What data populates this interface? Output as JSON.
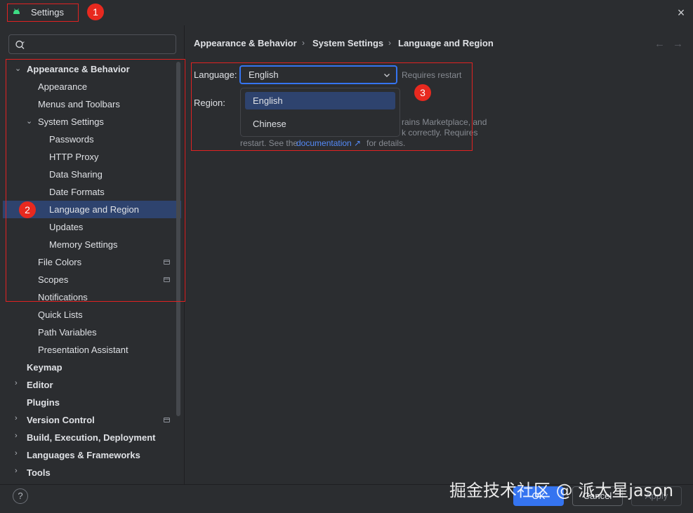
{
  "window": {
    "title": "Settings",
    "close_glyph": "×"
  },
  "annotations": [
    "1",
    "2",
    "3"
  ],
  "sidebar": {
    "search_placeholder": "",
    "items": [
      {
        "label": "Appearance & Behavior",
        "expanded": true
      },
      {
        "label": "Appearance"
      },
      {
        "label": "Menus and Toolbars"
      },
      {
        "label": "System Settings",
        "expanded": true
      },
      {
        "label": "Passwords"
      },
      {
        "label": "HTTP Proxy"
      },
      {
        "label": "Data Sharing"
      },
      {
        "label": "Date Formats"
      },
      {
        "label": "Language and Region",
        "selected": true
      },
      {
        "label": "Updates"
      },
      {
        "label": "Memory Settings"
      },
      {
        "label": "File Colors",
        "project_icon": true
      },
      {
        "label": "Scopes",
        "project_icon": true
      },
      {
        "label": "Notifications"
      },
      {
        "label": "Quick Lists"
      },
      {
        "label": "Path Variables"
      },
      {
        "label": "Presentation Assistant"
      },
      {
        "label": "Keymap"
      },
      {
        "label": "Editor",
        "expanded": false
      },
      {
        "label": "Plugins"
      },
      {
        "label": "Version Control",
        "expanded": false,
        "project_icon": true
      },
      {
        "label": "Build, Execution, Deployment",
        "expanded": false
      },
      {
        "label": "Languages & Frameworks",
        "expanded": false
      },
      {
        "label": "Tools",
        "expanded": false
      }
    ]
  },
  "breadcrumb": [
    "Appearance & Behavior",
    "System Settings",
    "Language and Region"
  ],
  "breadcrumb_sep": "›",
  "nav": {
    "back": "←",
    "forward": "→"
  },
  "language": {
    "label": "Language:",
    "value": "English",
    "hint": "Requires restart",
    "options": [
      "English",
      "Chinese"
    ]
  },
  "region": {
    "label": "Region:",
    "desc_line1": "rains Marketplace, and",
    "desc_line2": "k correctly. Requires",
    "desc_line3_prefix": "restart. See the",
    "desc_link": "documentation ↗",
    "desc_line3_suffix": "for details."
  },
  "footer": {
    "help": "?",
    "ok": "OK",
    "cancel": "Cancel",
    "apply": "Apply"
  },
  "watermark": "掘金技术社区 @ 派大星jason",
  "colors": {
    "background": "#2b2d30",
    "accent": "#3574f0",
    "selection": "#2e436e",
    "annotation_red": "#e12222",
    "link": "#548af7"
  }
}
